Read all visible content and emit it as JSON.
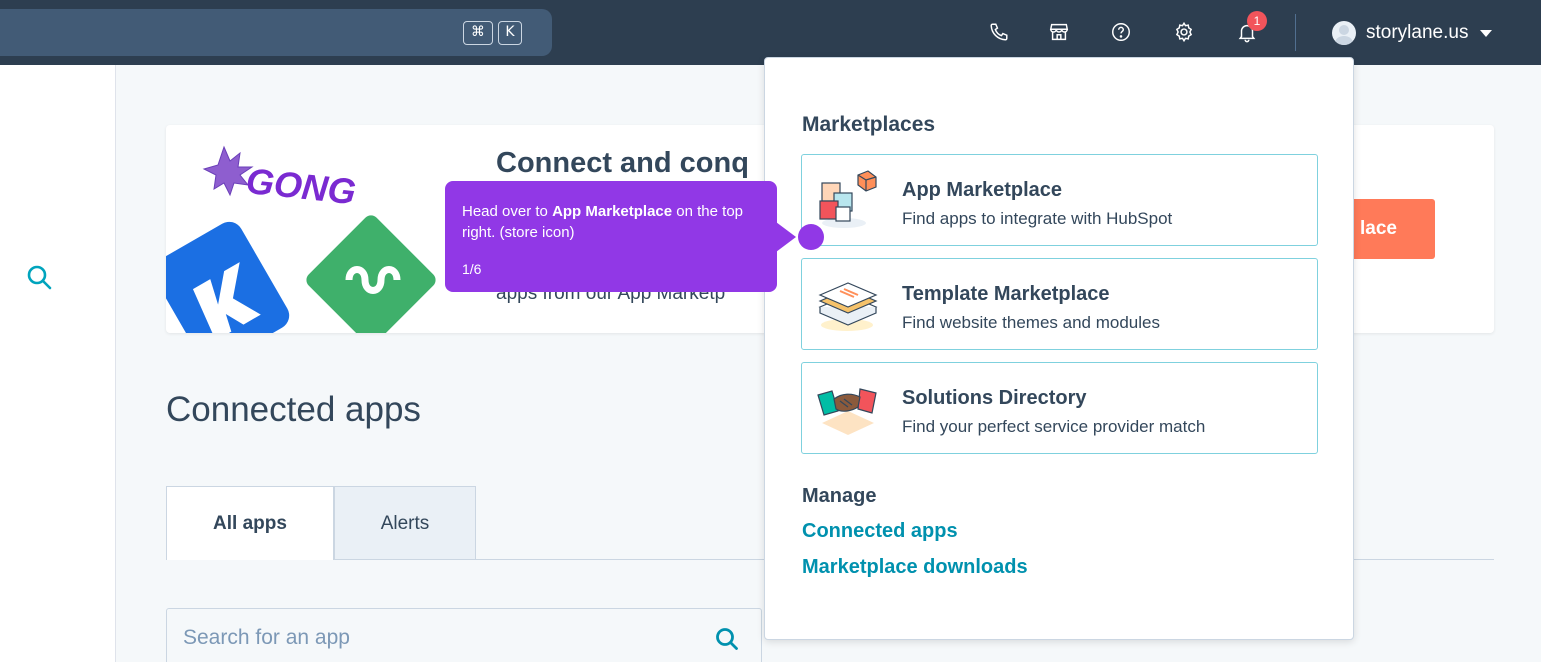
{
  "topbar": {
    "search_shortcut_cmd": "⌘",
    "search_shortcut_key": "K",
    "notifications_count": "1",
    "account_name": "storylane.us"
  },
  "banner": {
    "title": "Connect and conq",
    "text": "apps from our App Marketp",
    "cta_label": "lace"
  },
  "page": {
    "heading": "Connected apps",
    "tabs": [
      {
        "label": "All apps"
      },
      {
        "label": "Alerts"
      }
    ],
    "search_placeholder": "Search for an app"
  },
  "dropdown": {
    "marketplaces_heading": "Marketplaces",
    "cards": [
      {
        "title": "App Marketplace",
        "desc": "Find apps to integrate with HubSpot"
      },
      {
        "title": "Template Marketplace",
        "desc": "Find website themes and modules"
      },
      {
        "title": "Solutions Directory",
        "desc": "Find your perfect service provider match"
      }
    ],
    "manage_heading": "Manage",
    "links": [
      {
        "label": "Connected apps"
      },
      {
        "label": "Marketplace downloads"
      }
    ]
  },
  "tooltip": {
    "text_before": "Head over to ",
    "text_bold": "App Marketplace",
    "text_after": " on the top right. (store icon)",
    "step": "1/6"
  },
  "colors": {
    "nav_bg": "#2d3e50",
    "accent_orange": "#ff7a59",
    "link_teal": "#0091ae",
    "tooltip_purple": "#9138e6",
    "badge_red": "#f2545b"
  }
}
